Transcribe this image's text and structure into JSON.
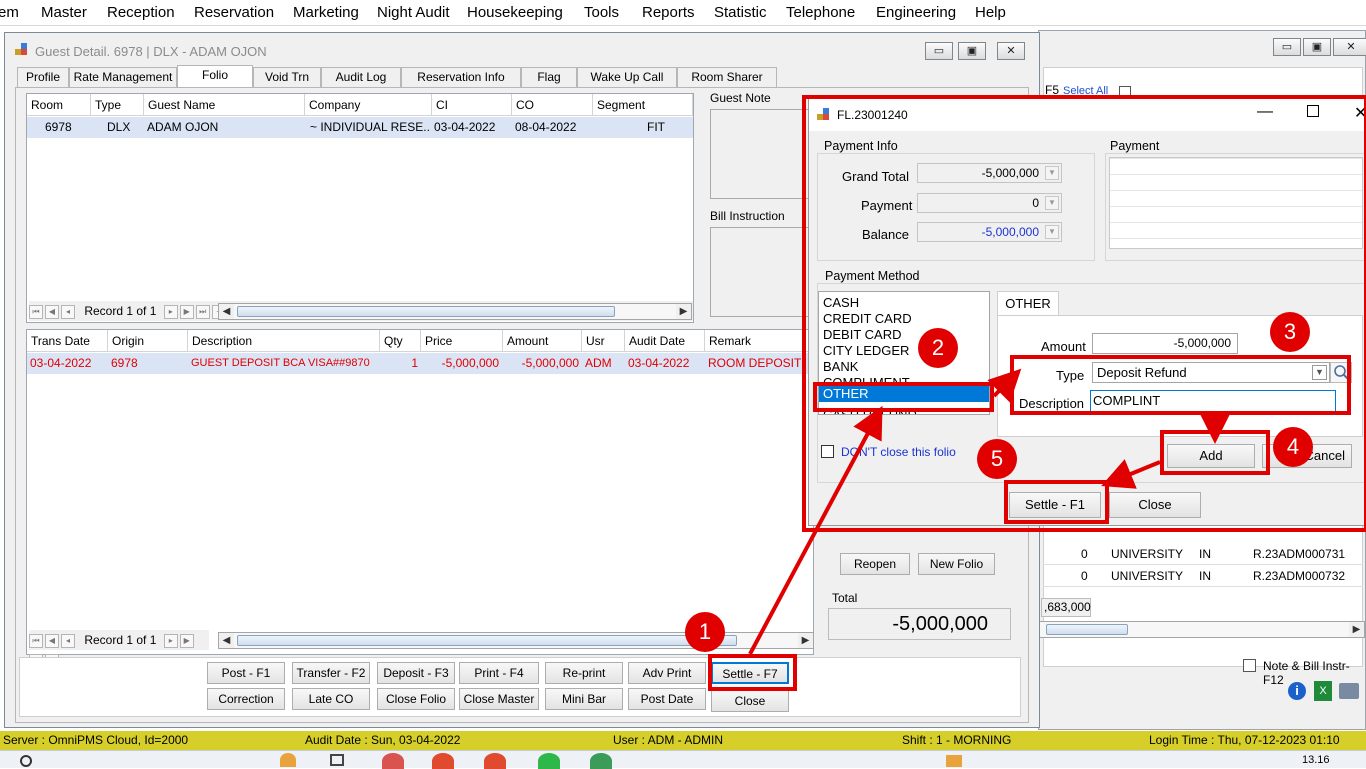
{
  "menu": [
    "em",
    "Master",
    "Reception",
    "Reservation",
    "Marketing",
    "Night Audit",
    "Housekeeping",
    "Tools",
    "Reports",
    "Statistic",
    "Telephone",
    "Engineering",
    "Help"
  ],
  "guest_window": {
    "title": "Guest Detail. 6978 | DLX - ADAM OJON",
    "tabs": [
      "Profile",
      "Rate Management",
      "Folio",
      "Void Trn",
      "Audit Log",
      "Reservation Info",
      "Flag",
      "Wake Up Call",
      "Room Sharer"
    ],
    "selected_tab": "Folio",
    "room_grid": {
      "headers": [
        "Room",
        "Type",
        "Guest Name",
        "Company",
        "CI",
        "CO",
        "Segment"
      ],
      "rows": [
        [
          "6978",
          "DLX",
          "ADAM OJON",
          "~ INDIVIDUAL RESE...",
          "03-04-2022",
          "08-04-2022",
          "FIT"
        ]
      ]
    },
    "record_label": "Record 1 of 1",
    "guest_note_label": "Guest Note",
    "bill_instruction_label": "Bill Instruction",
    "trans_grid": {
      "headers": [
        "Trans Date",
        "Origin",
        "Description",
        "Qty",
        "Price",
        "Amount",
        "Usr",
        "Audit Date",
        "Remark"
      ],
      "rows": [
        [
          "03-04-2022",
          "6978",
          "GUEST DEPOSIT BCA VISA##9870",
          "1",
          "-5,000,000",
          "-5,000,000",
          "ADM",
          "03-04-2022",
          "ROOM DEPOSIT"
        ]
      ]
    },
    "reopen_label": "Reopen",
    "new_folio_label": "New Folio",
    "total_label": "Total",
    "total_value": "-5,000,000",
    "buttons_row1": [
      "Post - F1",
      "Transfer - F2",
      "Deposit - F3",
      "Print - F4",
      "Re-print",
      "Adv Print",
      "Settle - F7"
    ],
    "buttons_row2": [
      "Correction",
      "Late CO",
      "Close Folio",
      "Close Master",
      "Mini Bar",
      "Post Date",
      "Close"
    ]
  },
  "bg_window": {
    "f5_label": "F5",
    "select_all": "Select All",
    "rows": [
      {
        "amount": "0",
        "name": "UNIVERSITY",
        "in": "IN",
        "ref": "R.23ADM000731"
      },
      {
        "amount": "0",
        "name": "UNIVERSITY",
        "in": "IN",
        "ref": "R.23ADM000732"
      }
    ],
    "total_value": ",683,000",
    "note_bill_label": "Note & Bill Instr-F12"
  },
  "payment_dialog": {
    "title": "FL.23001240",
    "payment_info_label": "Payment Info",
    "grand_total_label": "Grand Total",
    "grand_total_value": "-5,000,000",
    "payment_label": "Payment",
    "payment_value": "0",
    "balance_label": "Balance",
    "balance_value": "-5,000,000",
    "payment_box_label": "Payment",
    "payment_method_label": "Payment Method",
    "methods": [
      "CASH",
      "CREDIT CARD",
      "DEBIT CARD",
      "CITY LEDGER",
      "BANK",
      "COMPLIMENT",
      "OTHER",
      "CASH REFUND"
    ],
    "selected_method": "OTHER",
    "method_tab": "OTHER",
    "amount_label": "Amount",
    "amount_value": "-5,000,000",
    "type_label": "Type",
    "type_value": "Deposit Refund",
    "description_label": "Description",
    "description_value": "COMPLINT",
    "add_label": "Add",
    "cancel_label": "Cancel",
    "dont_close_label": "DON'T close this folio",
    "settle_label": "Settle - F1",
    "close_label": "Close"
  },
  "annotations": [
    "1",
    "2",
    "3",
    "4",
    "5"
  ],
  "statusbar": {
    "server": "Server : OmniPMS Cloud, Id=2000",
    "audit_date": "Audit Date : Sun, 03-04-2022",
    "user": "User : ADM - ADMIN",
    "shift": "Shift : 1 - MORNING",
    "login_time": "Login Time : Thu, 07-12-2023 01:10"
  },
  "taskbar": {
    "clock": "13.16"
  },
  "colors": {
    "annotation_red": "#e00000",
    "status_yellow": "#d6cf2a",
    "selection_blue": "#0078d7",
    "row_red_text": "#e00000"
  }
}
